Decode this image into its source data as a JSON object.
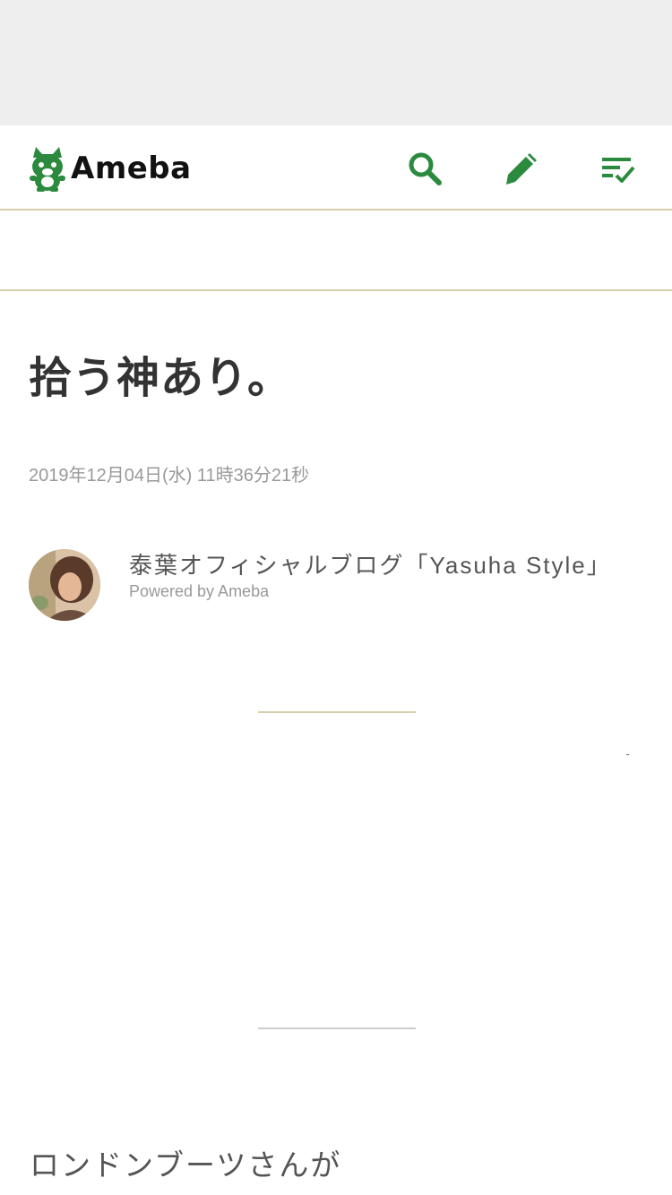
{
  "header": {
    "logo_text": "Ameba",
    "brand_color": "#2b8a3e",
    "icons": [
      "search-icon",
      "pencil-icon",
      "checklist-icon"
    ]
  },
  "article": {
    "title": "拾う神あり。",
    "date": "2019年12月04日(水) 11時36分21秒",
    "body_first_line": "ロンドンブーツさんが"
  },
  "blog": {
    "name": "泰葉オフィシャルブログ「Yasuha Style」",
    "powered_by": "Powered by Ameba"
  },
  "colors": {
    "divider": "#d6ceaa",
    "top_band": "#eeeeee",
    "meta_text": "#999999"
  }
}
